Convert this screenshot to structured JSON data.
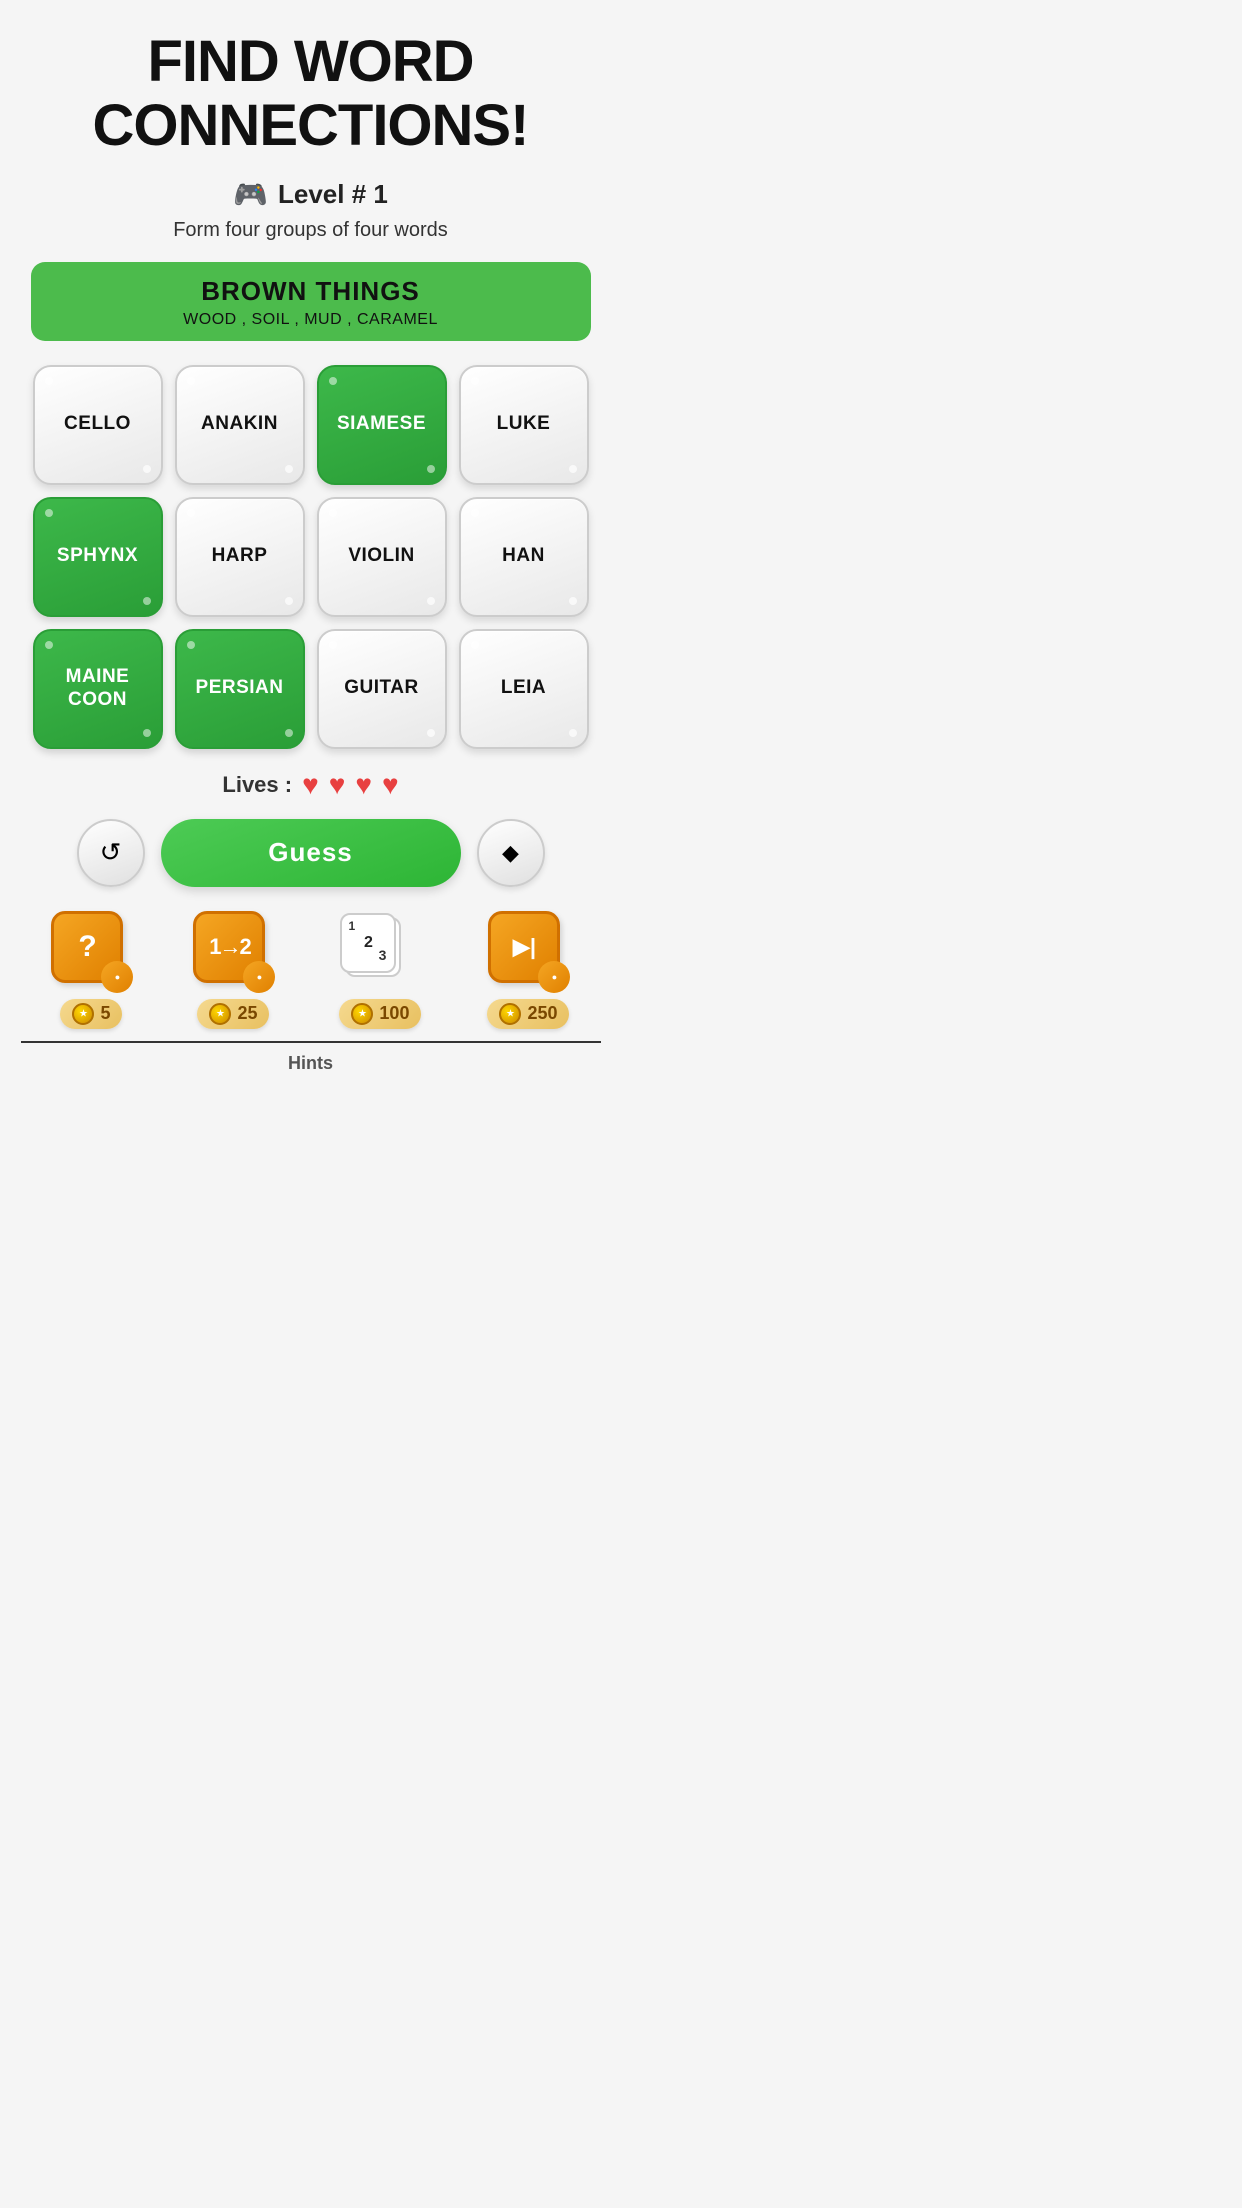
{
  "app": {
    "title_line1": "FIND WORD",
    "title_line2": "CONNECTIONS!",
    "level_icon": "🎮",
    "level_text": "Level # 1",
    "subtitle": "Form four groups of four words"
  },
  "revealed": {
    "category": "BROWN THINGS",
    "words": "WOOD , SOIL , MUD , CARAMEL"
  },
  "tiles": [
    {
      "word": "CELLO",
      "selected": false
    },
    {
      "word": "ANAKIN",
      "selected": false
    },
    {
      "word": "SIAMESE",
      "selected": true
    },
    {
      "word": "LUKE",
      "selected": false
    },
    {
      "word": "SPHYNX",
      "selected": true
    },
    {
      "word": "HARP",
      "selected": false
    },
    {
      "word": "VIOLIN",
      "selected": false
    },
    {
      "word": "HAN",
      "selected": false
    },
    {
      "word": "MAINE\nCOON",
      "selected": true
    },
    {
      "word": "PERSIAN",
      "selected": true
    },
    {
      "word": "GUITAR",
      "selected": false
    },
    {
      "word": "LEIA",
      "selected": false
    }
  ],
  "lives": {
    "label": "Lives :",
    "count": 4
  },
  "controls": {
    "guess_label": "Guess",
    "shuffle_icon": "↺",
    "eraser_icon": "◆"
  },
  "hints": [
    {
      "type": "question",
      "cost": "5",
      "icon": "?",
      "bg": "orange"
    },
    {
      "type": "swap",
      "cost": "25",
      "icon": "12",
      "bg": "orange"
    },
    {
      "type": "reveal",
      "cost": "100",
      "icon": "123",
      "bg": "white"
    },
    {
      "type": "skip",
      "cost": "250",
      "icon": "▶|",
      "bg": "orange"
    }
  ],
  "hints_label": "Hints"
}
